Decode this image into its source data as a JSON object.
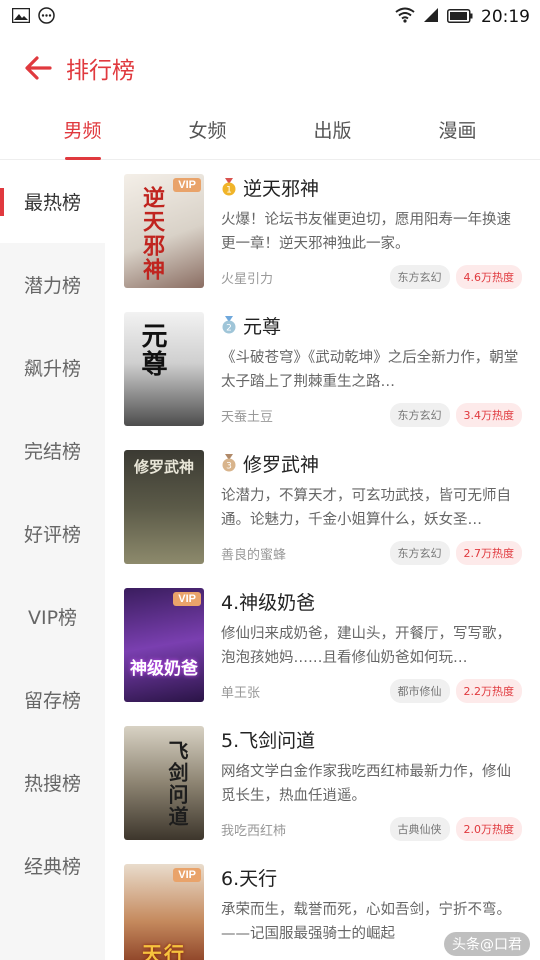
{
  "status": {
    "time": "20:19"
  },
  "header": {
    "title": "排行榜"
  },
  "tabs": [
    {
      "label": "男频",
      "active": true
    },
    {
      "label": "女频",
      "active": false
    },
    {
      "label": "出版",
      "active": false
    },
    {
      "label": "漫画",
      "active": false
    }
  ],
  "sidebar": [
    {
      "label": "最热榜",
      "active": true
    },
    {
      "label": "潜力榜"
    },
    {
      "label": "飙升榜"
    },
    {
      "label": "完结榜"
    },
    {
      "label": "好评榜"
    },
    {
      "label": "VIP榜"
    },
    {
      "label": "留存榜"
    },
    {
      "label": "热搜榜"
    },
    {
      "label": "经典榜"
    }
  ],
  "books": [
    {
      "rank_medal": "gold",
      "title": "逆天邪神",
      "cover_text": "逆天邪神",
      "vip": true,
      "desc": "火爆！论坛书友催更迫切，愿用阳寿一年换速更一章！逆天邪神独此一家。",
      "author": "火星引力",
      "category": "东方玄幻",
      "heat": "4.6万热度"
    },
    {
      "rank_medal": "silver",
      "title": "元尊",
      "cover_text": "元尊",
      "vip": false,
      "desc": "《斗破苍穹》《武动乾坤》之后全新力作，朝堂太子踏上了荆棘重生之路…",
      "author": "天蚕土豆",
      "category": "东方玄幻",
      "heat": "3.4万热度"
    },
    {
      "rank_medal": "bronze",
      "title": "修罗武神",
      "cover_text": "修罗武神",
      "vip": false,
      "desc": "论潜力，不算天才，可玄功武技，皆可无师自通。论魅力，千金小姐算什么，妖女圣…",
      "author": "善良的蜜蜂",
      "category": "东方玄幻",
      "heat": "2.7万热度"
    },
    {
      "rank_medal": "",
      "title": "4.神级奶爸",
      "cover_text": "神级奶爸",
      "vip": true,
      "desc": "修仙归来成奶爸，建山头，开餐厅，写写歌，泡泡孩她妈……且看修仙奶爸如何玩…",
      "author": "单王张",
      "category": "都市修仙",
      "heat": "2.2万热度"
    },
    {
      "rank_medal": "",
      "title": "5.飞剑问道",
      "cover_text": "飞剑问道",
      "vip": false,
      "desc": "网络文学白金作家我吃西红柿最新力作，修仙觅长生，热血任逍遥。",
      "author": "我吃西红柿",
      "category": "古典仙侠",
      "heat": "2.0万热度"
    },
    {
      "rank_medal": "",
      "title": "6.天行",
      "cover_text": "天行",
      "vip": true,
      "desc": "承荣而生，载誉而死，心如吾剑，宁折不弯。 ——记国服最强骑士的崛起",
      "author": "",
      "category": "",
      "heat": ""
    }
  ],
  "watermark": "头条@口君"
}
